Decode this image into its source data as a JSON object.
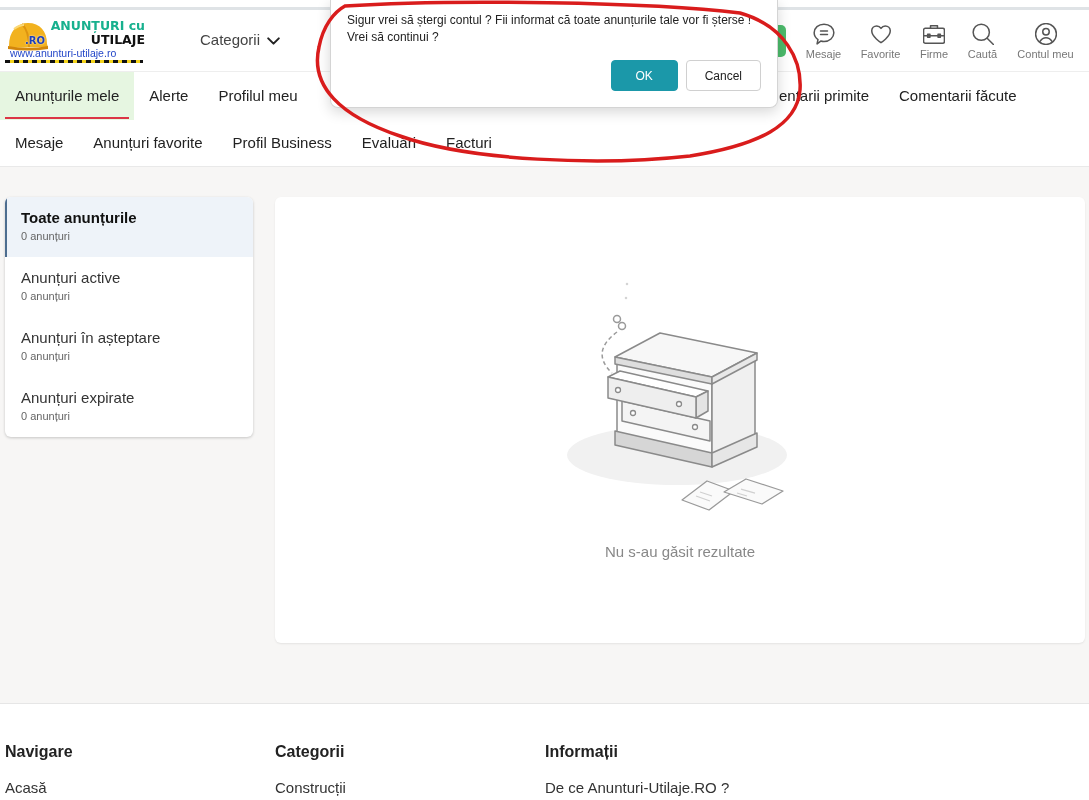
{
  "header": {
    "logo": {
      "title": "ANUNȚURI cu",
      "subtitle": "UTILAJE",
      "badge": ".RO",
      "url": "www.anunturi-utilaje.ro"
    },
    "categories_menu": {
      "label": "Categorii"
    },
    "nav_links": [
      {
        "label": "Mesaje"
      },
      {
        "label": "Favorite"
      },
      {
        "label": "Firme"
      },
      {
        "label": "Caută"
      },
      {
        "label": "Contul meu"
      }
    ]
  },
  "account_tabs": {
    "row_1_left": [
      {
        "label": "Anunțurile mele",
        "selected": true
      },
      {
        "label": "Alerte",
        "selected": false
      },
      {
        "label": "Profilul meu",
        "selected": false
      }
    ],
    "row_1_right": [
      {
        "label": "entarii primite",
        "selected": false
      },
      {
        "label": "Comentarii făcute",
        "selected": false
      }
    ],
    "row_2": [
      {
        "label": "Mesaje",
        "selected": false
      },
      {
        "label": "Anunțuri favorite",
        "selected": false
      },
      {
        "label": "Profil Business",
        "selected": false
      },
      {
        "label": "Evaluări",
        "selected": false
      },
      {
        "label": "Facturi",
        "selected": false
      }
    ]
  },
  "sidebar": {
    "items": [
      {
        "title": "Toate anunțurile",
        "count": "0 anunțuri",
        "selected": true
      },
      {
        "title": "Anunțuri active",
        "count": "0 anunțuri",
        "selected": false
      },
      {
        "title": "Anunțuri în așteptare",
        "count": "0 anunțuri",
        "selected": false
      },
      {
        "title": "Anunțuri expirate",
        "count": "0 anunțuri",
        "selected": false
      }
    ]
  },
  "results": {
    "empty_message": "Nu s-au găsit rezultate"
  },
  "footer": {
    "columns": [
      {
        "heading": "Navigare",
        "links": [
          "Acasă"
        ]
      },
      {
        "heading": "Categorii",
        "links": [
          "Construcții"
        ]
      },
      {
        "heading": "Informații",
        "links": [
          "De ce Anunturi-Utilaje.RO ?"
        ]
      }
    ]
  },
  "dialog": {
    "message": "Sigur vrei să ștergi contul ? Fii informat că toate anunțurile tale vor fi șterse !\nVrei să continui ?",
    "buttons": [
      {
        "label": "OK",
        "kind": "primary"
      },
      {
        "label": "Cancel",
        "kind": "secondary"
      }
    ]
  }
}
